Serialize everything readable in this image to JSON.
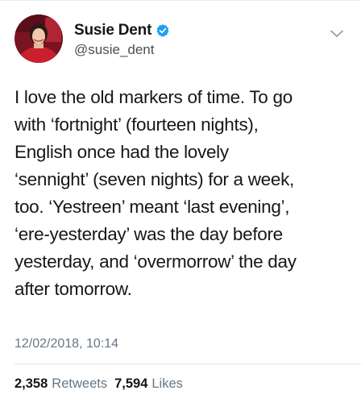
{
  "author": {
    "display_name": "Susie Dent",
    "handle": "@susie_dent",
    "verified_icon": "verified-badge-icon",
    "verified_color": "#1da1f2"
  },
  "tweet": {
    "lines": [
      "I love the old markers of time. To go",
      "with ‘fortnight’ (fourteen nights),",
      "English once had the lovely",
      "‘sennight’ (seven nights) for a week,",
      "too. ‘Yestreen’ meant ‘last evening’,",
      "‘ere-yesterday’ was the day before",
      "yesterday, and ‘overmorrow’ the day",
      "after tomorrow."
    ],
    "timestamp": "12/02/2018, 10:14"
  },
  "stats": {
    "retweets_count": "2,358",
    "retweets_label": "Retweets",
    "likes_count": "7,594",
    "likes_label": "Likes"
  },
  "icons": {
    "menu": "chevron-down-icon"
  }
}
